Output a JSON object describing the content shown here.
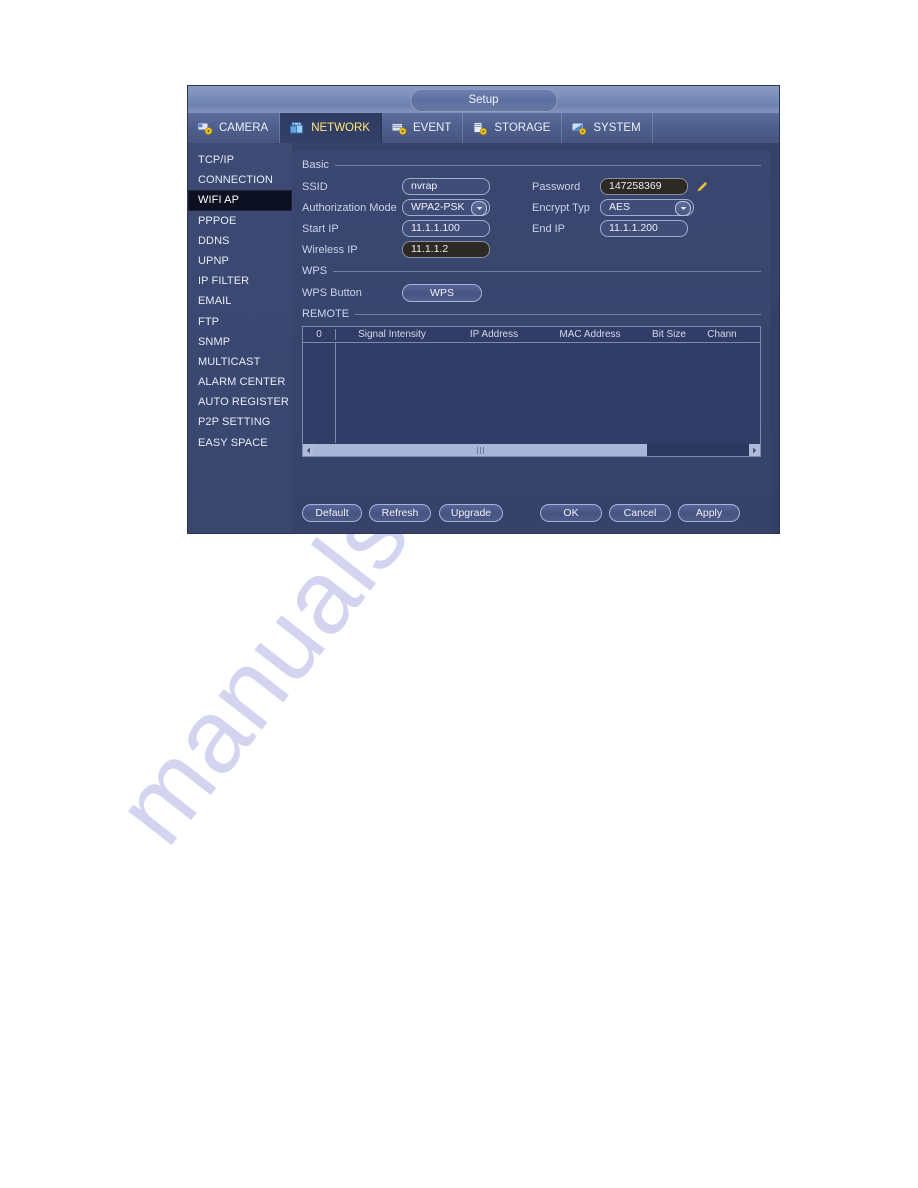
{
  "watermark": {
    "text": "manualshive.com"
  },
  "window": {
    "title": "Setup"
  },
  "tabs": [
    {
      "label": "CAMERA",
      "icon": "camera-gear-icon",
      "active": false
    },
    {
      "label": "NETWORK",
      "icon": "network-gear-icon",
      "active": true
    },
    {
      "label": "EVENT",
      "icon": "event-gear-icon",
      "active": false
    },
    {
      "label": "STORAGE",
      "icon": "storage-gear-icon",
      "active": false
    },
    {
      "label": "SYSTEM",
      "icon": "system-gear-icon",
      "active": false
    }
  ],
  "sidebar": {
    "items": [
      {
        "label": "TCP/IP",
        "active": false
      },
      {
        "label": "CONNECTION",
        "active": false
      },
      {
        "label": "WIFI AP",
        "active": true
      },
      {
        "label": "PPPOE",
        "active": false
      },
      {
        "label": "DDNS",
        "active": false
      },
      {
        "label": "UPNP",
        "active": false
      },
      {
        "label": "IP FILTER",
        "active": false
      },
      {
        "label": "EMAIL",
        "active": false
      },
      {
        "label": "FTP",
        "active": false
      },
      {
        "label": "SNMP",
        "active": false
      },
      {
        "label": "MULTICAST",
        "active": false
      },
      {
        "label": "ALARM CENTER",
        "active": false
      },
      {
        "label": "AUTO REGISTER",
        "active": false
      },
      {
        "label": "P2P SETTING",
        "active": false
      },
      {
        "label": "EASY SPACE",
        "active": false
      }
    ]
  },
  "basic": {
    "heading": "Basic",
    "ssid_label": "SSID",
    "ssid_value": "nvrap",
    "password_label": "Password",
    "password_value": "147258369",
    "auth_label": "Authorization Mode",
    "auth_value": "WPA2-PSK",
    "encrypt_label": "Encrypt Typ",
    "encrypt_value": "AES",
    "start_ip_label": "Start IP",
    "start_ip_value": "11.1.1.100",
    "end_ip_label": "End IP",
    "end_ip_value": "11.1.1.200",
    "wireless_ip_label": "Wireless IP",
    "wireless_ip_value": "11.1.1.2"
  },
  "wps": {
    "heading": "WPS",
    "button_label": "WPS Button",
    "button_text": "WPS"
  },
  "remote": {
    "heading": "REMOTE",
    "columns": [
      "0",
      "Signal Intensity",
      "IP Address",
      "MAC Address",
      "Bit Size",
      "Chann"
    ],
    "rows": []
  },
  "footer": {
    "default_label": "Default",
    "refresh_label": "Refresh",
    "upgrade_label": "Upgrade",
    "ok_label": "OK",
    "cancel_label": "Cancel",
    "apply_label": "Apply"
  },
  "colors": {
    "window_bg": "#36426a",
    "tab_active_text": "#ffe87a",
    "sidebar_active_bg": "#0c1020",
    "accent_pencil": "#e8c13c",
    "watermark": "#b9bce8"
  }
}
